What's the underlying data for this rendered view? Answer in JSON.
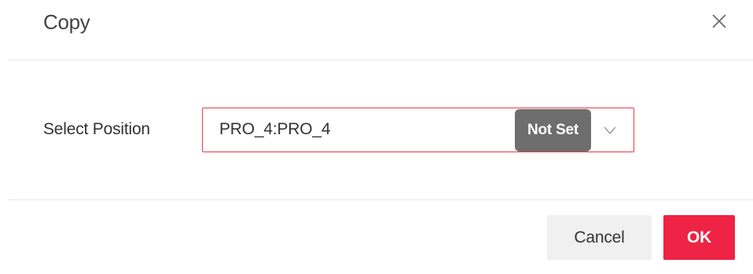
{
  "dialog": {
    "title": "Copy",
    "close_icon": "close-icon"
  },
  "form": {
    "position_label": "Select Position",
    "position_select": {
      "value": "PRO_4:PRO_4",
      "badge": "Not Set",
      "dropdown_icon": "chevron-down-icon",
      "border_color": "#e8394d"
    }
  },
  "footer": {
    "cancel_label": "Cancel",
    "ok_label": "OK",
    "ok_color": "#ee2345"
  }
}
